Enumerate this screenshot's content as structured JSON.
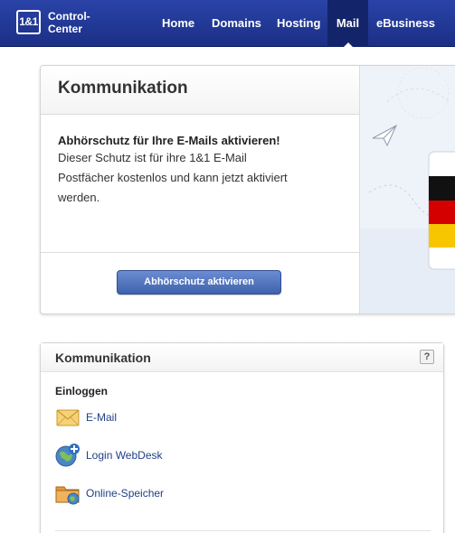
{
  "header": {
    "logo_text": "1&1",
    "brand_line1": "Control-",
    "brand_line2": "Center",
    "nav": [
      {
        "label": "Home"
      },
      {
        "label": "Domains"
      },
      {
        "label": "Hosting"
      },
      {
        "label": "Mail"
      },
      {
        "label": "eBusiness"
      }
    ],
    "active_nav": "Mail",
    "colors": {
      "bar": "#1f3591",
      "active": "#14246a"
    }
  },
  "promo": {
    "title": "Kommunikation",
    "subtitle": "Abhörschutz für Ihre E-Mails aktivieren!",
    "body": "Dieser Schutz ist für ihre 1&1 E-Mail Postfächer kostenlos und kann jetzt aktiviert werden.",
    "button_label": "Abhörschutz aktivieren",
    "art_icons": [
      "paper-plane-icon",
      "germany-flag-icon"
    ]
  },
  "communication": {
    "title": "Kommunikation",
    "help_label": "?",
    "section_label": "Einloggen",
    "links": [
      {
        "label": "E-Mail",
        "icon": "envelope-icon"
      },
      {
        "label": "Login WebDesk",
        "icon": "globe-plus-icon"
      },
      {
        "label": "Online-Speicher",
        "icon": "folder-globe-icon"
      }
    ]
  }
}
